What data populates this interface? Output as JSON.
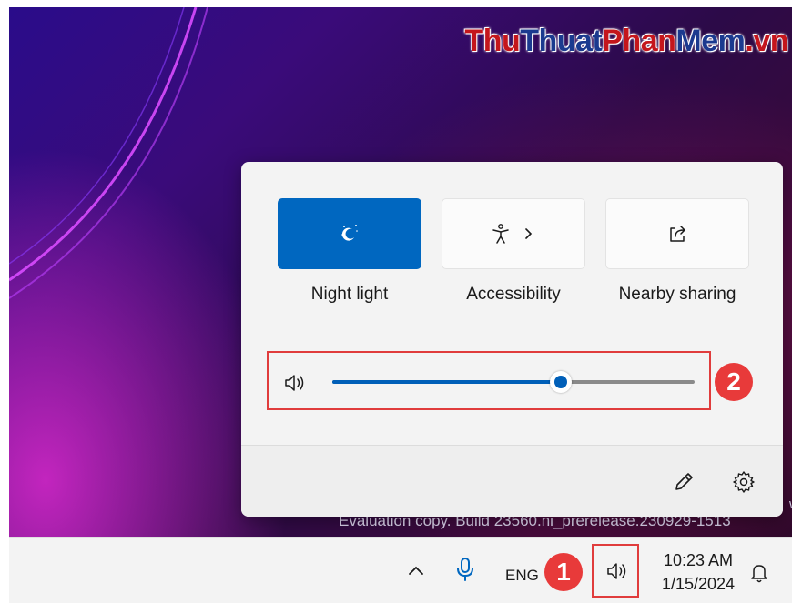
{
  "watermark": {
    "part1": "Thu",
    "part2": "Thuat",
    "part3": "Phan",
    "part4": "Mem",
    "part5": ".vn"
  },
  "desktop": {
    "eval_text": "Evaluation copy. Build 23560.ni_prerelease.230929-1513",
    "eval_w": "w"
  },
  "quick_settings": {
    "tiles": [
      {
        "label": "Night light",
        "icon": "night-light-icon",
        "active": true
      },
      {
        "label": "Accessibility",
        "icon": "accessibility-icon",
        "active": false,
        "has_chevron": true
      },
      {
        "label": "Nearby sharing",
        "icon": "share-icon",
        "active": false
      }
    ],
    "volume": {
      "icon": "speaker-icon",
      "level_percent": 63
    },
    "footer": {
      "edit_icon": "pencil-icon",
      "settings_icon": "gear-icon"
    }
  },
  "annotations": {
    "badge1": "1",
    "badge2": "2"
  },
  "taskbar": {
    "chevron_icon": "chevron-up-icon",
    "mic_icon": "microphone-icon",
    "language": "ENG",
    "volume_icon": "speaker-icon",
    "time": "10:23 AM",
    "date": "1/15/2024",
    "notification_icon": "bell-icon"
  },
  "colors": {
    "accent": "#0067c0",
    "annotation": "#e03c3c"
  }
}
